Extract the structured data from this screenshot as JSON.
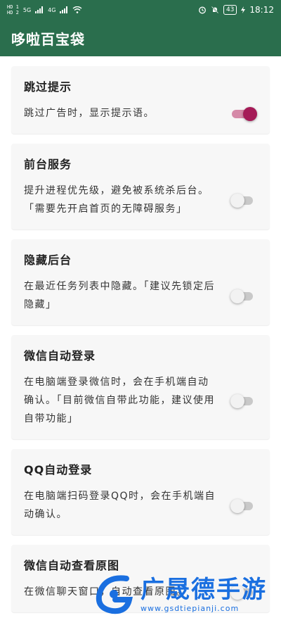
{
  "status_bar": {
    "sim_top": "HD 1",
    "sim_bottom": "HD 2",
    "signal_1": "5G",
    "signal_2": "4G",
    "battery": "43",
    "time": "18:12"
  },
  "app": {
    "title": "哆啦百宝袋",
    "theme_color": "#2a6e4d"
  },
  "settings": [
    {
      "title": "跳过提示",
      "desc": "跳过广告时，显示提示语。",
      "enabled": true
    },
    {
      "title": "前台服务",
      "desc": "提升进程优先级，避免被系统杀后台。「需要先开启首页的无障碍服务」",
      "enabled": false
    },
    {
      "title": "隐藏后台",
      "desc": "在最近任务列表中隐藏。「建议先锁定后隐藏」",
      "enabled": false
    },
    {
      "title": "微信自动登录",
      "desc": "在电脑端登录微信时，会在手机端自动确认。「目前微信自带此功能，建议使用自带功能」",
      "enabled": false
    },
    {
      "title": "QQ自动登录",
      "desc": "在电脑端扫码登录QQ时，会在手机端自动确认。",
      "enabled": false
    },
    {
      "title": "微信自动查看原图",
      "desc": "在微信聊天窗口，自动查看原图。",
      "enabled": false
    }
  ],
  "watermark": {
    "name": "广晟德手游",
    "url": "www.gsdtiepianji.com"
  }
}
